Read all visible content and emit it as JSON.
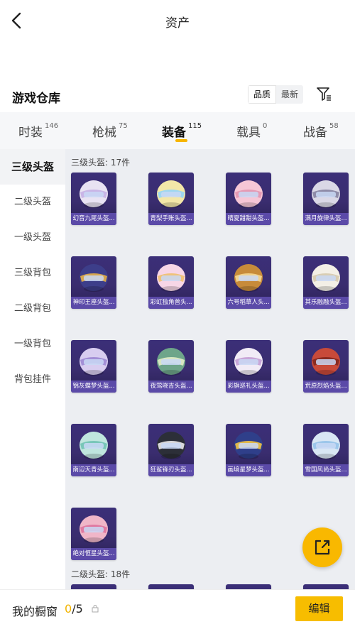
{
  "header": {
    "title": "资产"
  },
  "section": {
    "title": "游戏仓库",
    "sort_options": [
      "品质",
      "最新"
    ],
    "active_sort": 0
  },
  "tabs": [
    {
      "label": "时装",
      "count": "146"
    },
    {
      "label": "枪械",
      "count": "75"
    },
    {
      "label": "装备",
      "count": "115"
    },
    {
      "label": "载具",
      "count": "0"
    },
    {
      "label": "战备",
      "count": "58"
    }
  ],
  "sidebar": [
    "三级头盔",
    "二级头盔",
    "一级头盔",
    "三级背包",
    "二级背包",
    "一级背包",
    "背包挂件"
  ],
  "groups": [
    {
      "label": "三级头盔: 17件",
      "items": [
        "幻音九尾头盔...",
        "青梨手账头盔...",
        "晴夏甜甜头盔...",
        "满月旋律头盔...",
        "神印王座头盔...",
        "彩虹独角兽头...",
        "六号稻草人头...",
        "其乐融融头盔...",
        "锦灰蝶梦头盔...",
        "夜莺晓吉头盔...",
        "彩旗巡礼头盔...",
        "荒原烈焰头盔...",
        "南辺天青头盔...",
        "狂鲨锋刃头盔...",
        "画境星梦头盔...",
        "雪国风尚头盔...",
        "绝对恒星头盔..."
      ]
    },
    {
      "label": "二级头盔: 18件",
      "items": []
    }
  ],
  "colors": {
    "accent": "#f7b500",
    "card_bg": "#3b2f78",
    "card_caption": "#5b4aa8"
  },
  "bottom": {
    "label": "我的橱窗",
    "count_current": "0",
    "count_total": "/5",
    "edit_label": "编辑"
  },
  "icons": {
    "back": "chevron-left-icon",
    "filter": "filter-icon",
    "lock": "lock-icon",
    "share": "share-out-icon"
  }
}
